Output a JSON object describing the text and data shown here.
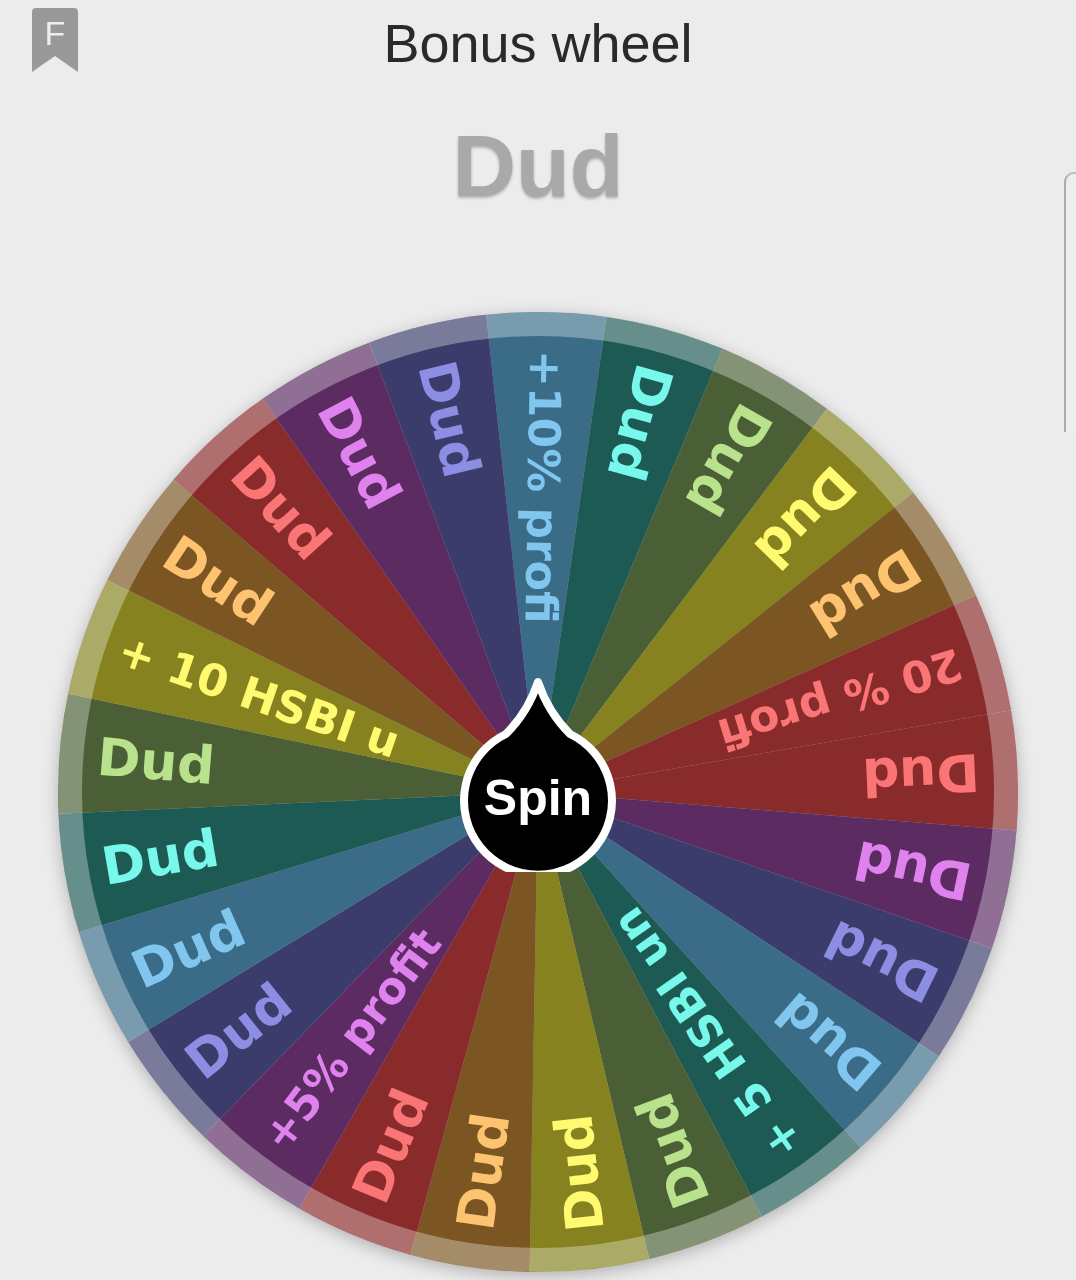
{
  "header": {
    "badge_letter": "F",
    "title": "Bonus wheel"
  },
  "result": "Dud",
  "wheel": {
    "segments": [
      {
        "label": "+10% profi",
        "color": "#3a6c88"
      },
      {
        "label": "Dud",
        "color": "#1e5a54"
      },
      {
        "label": "Dud",
        "color": "#4b5f36"
      },
      {
        "label": "Dud",
        "color": "#85821f"
      },
      {
        "label": "Dud",
        "color": "#7b5622"
      },
      {
        "label": "20 % profi",
        "color": "#8a2b2b"
      },
      {
        "label": "Dud",
        "color": "#8a2b2b"
      },
      {
        "label": "Dud",
        "color": "#5b2b62"
      },
      {
        "label": "Dud",
        "color": "#3b3c6c"
      },
      {
        "label": "Dud",
        "color": "#3a6c88"
      },
      {
        "label": "+ 5 HSBI un",
        "color": "#1e5a54"
      },
      {
        "label": "Dud",
        "color": "#4b5f36"
      },
      {
        "label": "Dud",
        "color": "#85821f"
      },
      {
        "label": "Dud",
        "color": "#7b5622"
      },
      {
        "label": "Dud",
        "color": "#8a2b2b"
      },
      {
        "label": "+5% profit",
        "color": "#5b2b62"
      },
      {
        "label": "Dud",
        "color": "#3b3c6c"
      },
      {
        "label": "Dud",
        "color": "#3a6c88"
      },
      {
        "label": "Dud",
        "color": "#1e5a54"
      },
      {
        "label": "Dud",
        "color": "#4b5f36"
      },
      {
        "label": "+ 10 HSBI u",
        "color": "#85821f"
      },
      {
        "label": "Dud",
        "color": "#7b5622"
      },
      {
        "label": "Dud",
        "color": "#8a2b2b"
      },
      {
        "label": "Dud",
        "color": "#5b2b62"
      },
      {
        "label": "Dud",
        "color": "#3b3c6c"
      }
    ],
    "spin_label": "Spin"
  }
}
